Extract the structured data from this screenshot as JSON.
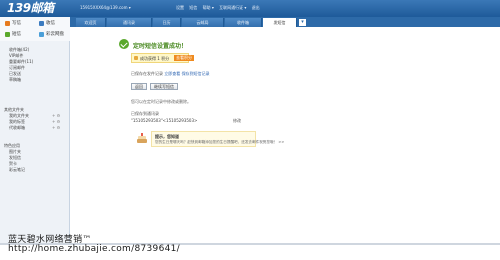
{
  "header": {
    "logo": "139邮箱",
    "account": "15915XXX64@139.com ▾",
    "nav": [
      "设置",
      "短信",
      "帮助 ▾",
      "互联网通行证 ▾",
      "退出"
    ],
    "right": ""
  },
  "tabs": [
    {
      "label": "欢迎页",
      "active": false
    },
    {
      "label": "通讯录",
      "active": false
    },
    {
      "label": "日历",
      "active": false
    },
    {
      "label": "云邮局",
      "active": false
    },
    {
      "label": "收件箱",
      "active": false
    },
    {
      "label": "发短信",
      "active": true
    }
  ],
  "sidebar": {
    "actions": [
      {
        "label": "写信",
        "icon": "pen-icon"
      },
      {
        "label": "收信",
        "icon": "envelope-icon"
      },
      {
        "label": "短信",
        "icon": "sms-icon"
      },
      {
        "label": "彩云网盘",
        "icon": "cloud-icon"
      }
    ],
    "folders": [
      "收件箱(42)",
      "VIP邮件",
      "重要邮件(11)",
      "订阅邮件",
      "已发送",
      "草稿箱"
    ],
    "group1_title": "其他文件夹",
    "group1_items": [
      "我的文件夹",
      "我的标签",
      "代收邮箱"
    ],
    "group2_title": "特色应用",
    "group2_items": [
      "图片夹",
      "发短信",
      "贺卡",
      "彩云笔记"
    ]
  },
  "main": {
    "title": "定时短信设置成功！",
    "notice_text": "成功获得 1 积分",
    "notice_button": "去看积分",
    "line1_prefix": "已保存在发件记录",
    "line1_link1": "立即查看",
    "line1_link2": "保存到短信记录",
    "btn_back": "返回",
    "btn_continue": "继续写短信",
    "line2": "您可以在定时记录中修改或删除。",
    "line3": "已保存到通讯录",
    "emails": "\"15105293503\"<15105293503>",
    "modify": "修改",
    "bday_title": "提示，您知道",
    "bday_body": "您的生日是哪天吗？赶快到邮箱添加您的生日提醒吧，还发去邮件祝贺您哦！ >>"
  },
  "watermark": {
    "line1": "蓝天碧水网络营销™",
    "line2": "http://home.zhubajie.com/8739641/"
  }
}
